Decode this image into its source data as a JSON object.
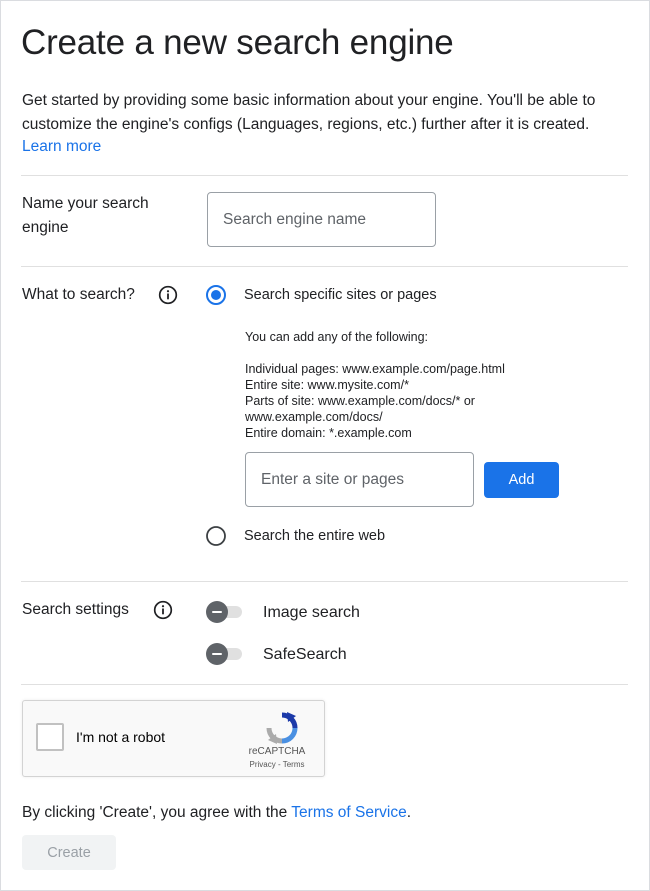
{
  "page": {
    "title": "Create a new search engine",
    "intro": "Get started by providing some basic information about your engine. You'll be able to customize the engine's configs (Languages, regions, etc.) further after it is created.",
    "learn_more": "Learn more"
  },
  "name_section": {
    "label": "Name your search engine",
    "input_placeholder": "Search engine name",
    "input_value": ""
  },
  "what_section": {
    "label": "What to search?",
    "info_icon": "info-icon",
    "option_specific": "Search specific sites or pages",
    "option_specific_selected": true,
    "hint_intro": "You can add any of the following:",
    "hint_lines": [
      "Individual pages: www.example.com/page.html",
      "Entire site: www.mysite.com/*",
      "Parts of site: www.example.com/docs/* or",
      "www.example.com/docs/",
      "Entire domain: *.example.com"
    ],
    "site_placeholder": "Enter a site or pages",
    "site_value": "",
    "add_label": "Add",
    "option_web": "Search the entire web",
    "option_web_selected": false
  },
  "settings_section": {
    "label": "Search settings",
    "info_icon": "info-icon",
    "toggles": [
      {
        "label": "Image search",
        "on": false
      },
      {
        "label": "SafeSearch",
        "on": false
      }
    ]
  },
  "captcha": {
    "label": "I'm not a robot",
    "brand": "reCAPTCHA",
    "legal": "Privacy - Terms",
    "checked": false
  },
  "footer": {
    "terms_prefix": "By clicking 'Create', you agree with the ",
    "terms_link": "Terms of Service",
    "terms_suffix": ".",
    "create_label": "Create",
    "create_enabled": false
  },
  "colors": {
    "accent": "#1a73e8",
    "text": "#202124",
    "divider": "#e0e0e0",
    "toggle_knob": "#5f6368",
    "disabled_button_bg": "#f1f3f4"
  }
}
